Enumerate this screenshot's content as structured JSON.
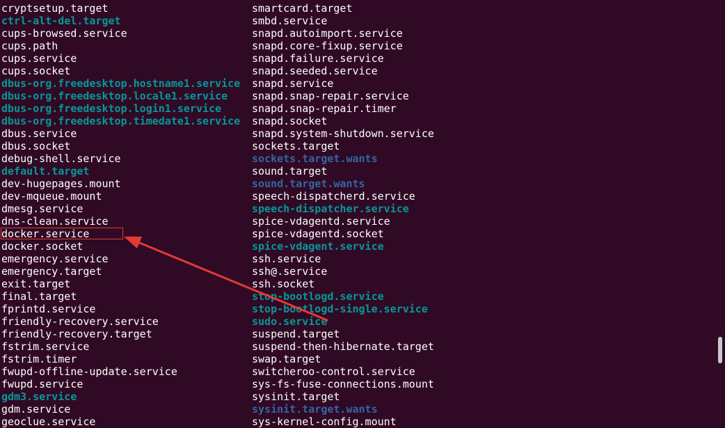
{
  "terminal": {
    "colors": {
      "background": "#300a24",
      "file": "#ffffff",
      "symlink": "#06989a",
      "directory": "#3465a4",
      "annotation": "#e53935"
    },
    "left_column": [
      {
        "name": "cryptsetup.target",
        "kind": "file"
      },
      {
        "name": "ctrl-alt-del.target",
        "kind": "link"
      },
      {
        "name": "cups-browsed.service",
        "kind": "file"
      },
      {
        "name": "cups.path",
        "kind": "file"
      },
      {
        "name": "cups.service",
        "kind": "file"
      },
      {
        "name": "cups.socket",
        "kind": "file"
      },
      {
        "name": "dbus-org.freedesktop.hostname1.service",
        "kind": "link"
      },
      {
        "name": "dbus-org.freedesktop.locale1.service",
        "kind": "link"
      },
      {
        "name": "dbus-org.freedesktop.login1.service",
        "kind": "link"
      },
      {
        "name": "dbus-org.freedesktop.timedate1.service",
        "kind": "link"
      },
      {
        "name": "dbus.service",
        "kind": "file"
      },
      {
        "name": "dbus.socket",
        "kind": "file"
      },
      {
        "name": "debug-shell.service",
        "kind": "file"
      },
      {
        "name": "default.target",
        "kind": "link"
      },
      {
        "name": "dev-hugepages.mount",
        "kind": "file"
      },
      {
        "name": "dev-mqueue.mount",
        "kind": "file"
      },
      {
        "name": "dmesg.service",
        "kind": "file"
      },
      {
        "name": "dns-clean.service",
        "kind": "file"
      },
      {
        "name": "docker.service",
        "kind": "file"
      },
      {
        "name": "docker.socket",
        "kind": "file"
      },
      {
        "name": "emergency.service",
        "kind": "file"
      },
      {
        "name": "emergency.target",
        "kind": "file"
      },
      {
        "name": "exit.target",
        "kind": "file"
      },
      {
        "name": "final.target",
        "kind": "file"
      },
      {
        "name": "fprintd.service",
        "kind": "file"
      },
      {
        "name": "friendly-recovery.service",
        "kind": "file"
      },
      {
        "name": "friendly-recovery.target",
        "kind": "file"
      },
      {
        "name": "fstrim.service",
        "kind": "file"
      },
      {
        "name": "fstrim.timer",
        "kind": "file"
      },
      {
        "name": "fwupd-offline-update.service",
        "kind": "file"
      },
      {
        "name": "fwupd.service",
        "kind": "file"
      },
      {
        "name": "gdm3.service",
        "kind": "link"
      },
      {
        "name": "gdm.service",
        "kind": "file"
      },
      {
        "name": "geoclue.service",
        "kind": "file"
      }
    ],
    "right_column": [
      {
        "name": "smartcard.target",
        "kind": "file"
      },
      {
        "name": "smbd.service",
        "kind": "file"
      },
      {
        "name": "snapd.autoimport.service",
        "kind": "file"
      },
      {
        "name": "snapd.core-fixup.service",
        "kind": "file"
      },
      {
        "name": "snapd.failure.service",
        "kind": "file"
      },
      {
        "name": "snapd.seeded.service",
        "kind": "file"
      },
      {
        "name": "snapd.service",
        "kind": "file"
      },
      {
        "name": "snapd.snap-repair.service",
        "kind": "file"
      },
      {
        "name": "snapd.snap-repair.timer",
        "kind": "file"
      },
      {
        "name": "snapd.socket",
        "kind": "file"
      },
      {
        "name": "snapd.system-shutdown.service",
        "kind": "file"
      },
      {
        "name": "sockets.target",
        "kind": "file"
      },
      {
        "name": "sockets.target.wants",
        "kind": "dir"
      },
      {
        "name": "sound.target",
        "kind": "file"
      },
      {
        "name": "sound.target.wants",
        "kind": "dir"
      },
      {
        "name": "speech-dispatcherd.service",
        "kind": "file"
      },
      {
        "name": "speech-dispatcher.service",
        "kind": "link"
      },
      {
        "name": "spice-vdagentd.service",
        "kind": "file"
      },
      {
        "name": "spice-vdagentd.socket",
        "kind": "file"
      },
      {
        "name": "spice-vdagent.service",
        "kind": "link"
      },
      {
        "name": "ssh.service",
        "kind": "file"
      },
      {
        "name": "ssh@.service",
        "kind": "file"
      },
      {
        "name": "ssh.socket",
        "kind": "file"
      },
      {
        "name": "stop-bootlogd.service",
        "kind": "link"
      },
      {
        "name": "stop-bootlogd-single.service",
        "kind": "link"
      },
      {
        "name": "sudo.service",
        "kind": "link"
      },
      {
        "name": "suspend.target",
        "kind": "file"
      },
      {
        "name": "suspend-then-hibernate.target",
        "kind": "file"
      },
      {
        "name": "swap.target",
        "kind": "file"
      },
      {
        "name": "switcheroo-control.service",
        "kind": "file"
      },
      {
        "name": "sys-fs-fuse-connections.mount",
        "kind": "file"
      },
      {
        "name": "sysinit.target",
        "kind": "file"
      },
      {
        "name": "sysinit.target.wants",
        "kind": "dir"
      },
      {
        "name": "sys-kernel-config.mount",
        "kind": "file"
      }
    ],
    "highlighted_entry": "docker.service",
    "scrollbar": {
      "position_fraction": 0.82
    }
  }
}
